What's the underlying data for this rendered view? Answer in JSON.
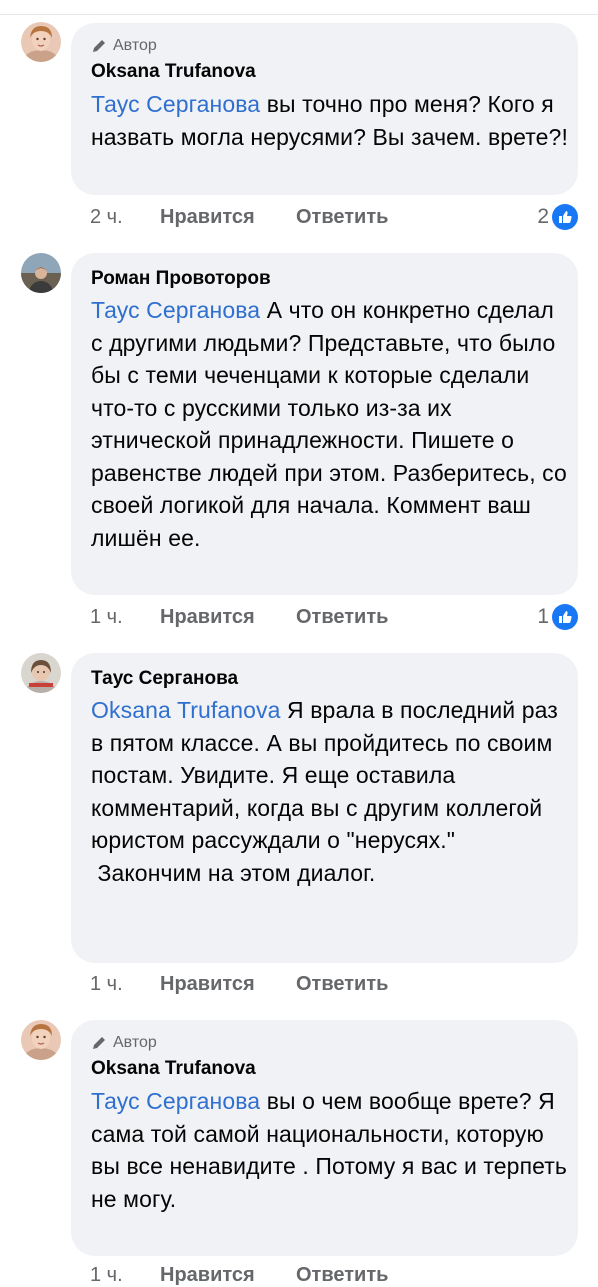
{
  "comments": [
    {
      "author": "Oksana Trufanova",
      "badge": "Автор",
      "mention": "Таус Серганова",
      "text": " вы точно про меня? Кого я назвать могла нерусями? Вы зачем. врете?!",
      "time": "2 ч.",
      "like_label": "Нравится",
      "reply_label": "Ответить",
      "reactions": "2"
    },
    {
      "author": "Роман Провоторов",
      "mention": "Таус Серганова",
      "text": " А что он конкретно сделал с другими людьми? Представьте, что было бы с теми чеченцами к которые сделали что-то с русскими только из-за их этнической принадлежности. Пишете о равенстве людей при этом. Разберитесь, со своей логикой для начала. Коммент ваш лишён ее.",
      "time": "1 ч.",
      "like_label": "Нравится",
      "reply_label": "Ответить",
      "reactions": "1"
    },
    {
      "author": "Таус Серганова",
      "mention": "Oksana Trufanova",
      "text": " Я врала в последний раз в пятом классе. А вы пройдитесь по своим постам. Увидите. Я еще оставила комментарий, когда вы с другим коллегой юристом рассуждали о \"нерусях.\"\n Закончим на этом диалог.",
      "time": "1 ч.",
      "like_label": "Нравится",
      "reply_label": "Ответить"
    },
    {
      "author": "Oksana Trufanova",
      "badge": "Автор",
      "mention": "Таус Серганова",
      "text": " вы о чем вообще врете? Я сама той самой национальности, которую вы все ненавидите . Потому я вас и терпеть не могу.",
      "time": "1 ч.",
      "like_label": "Нравится",
      "reply_label": "Ответить"
    }
  ],
  "colors": {
    "bubble": "#f0f2f5",
    "mention": "#2f6fcf",
    "like_badge": "#1877f2",
    "meta": "#65676b"
  }
}
